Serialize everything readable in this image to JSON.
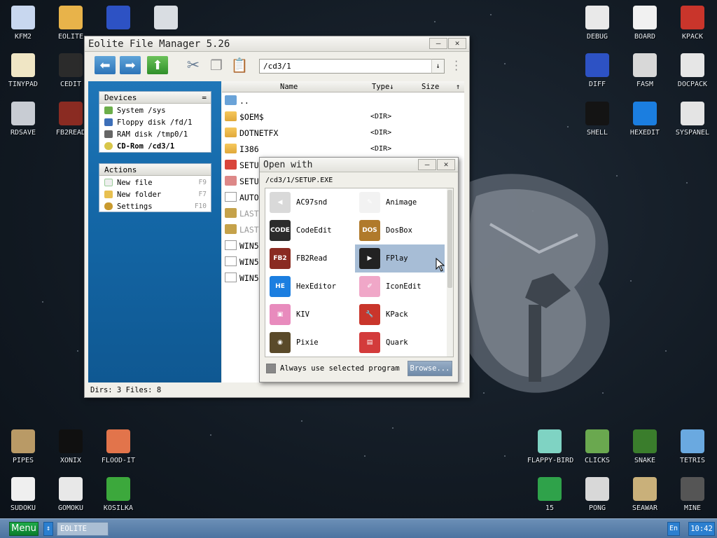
{
  "desktop": {
    "icons_left": [
      {
        "label": "KFM2",
        "icon": "floppy-icon",
        "color": "#c8d7ef"
      },
      {
        "label": "EOLITE",
        "icon": "folder-icon",
        "color": "#e8b34a"
      },
      {
        "label": "",
        "icon": "screen-grid-icon",
        "color": "#2d52c4"
      },
      {
        "label": "",
        "icon": "calculator-icon",
        "color": "#d9dde2"
      },
      {
        "label": "TINYPAD",
        "icon": "notepad-icon",
        "color": "#f0e6c5"
      },
      {
        "label": "CEDIT",
        "icon": "code-icon",
        "color": "#2b2b2b"
      },
      {
        "label": "RDSAVE",
        "icon": "ramdisk-icon",
        "color": "#c8ccd3"
      },
      {
        "label": "FB2READ",
        "icon": "book-icon",
        "color": "#8a2b22"
      }
    ],
    "icons_right": [
      {
        "label": "DEBUG",
        "icon": "debug-icon",
        "color": "#e9e9e9"
      },
      {
        "label": "BOARD",
        "icon": "board-icon",
        "color": "#f1f1f1"
      },
      {
        "label": "KPACK",
        "icon": "wrench-icon",
        "color": "#c9352b"
      },
      {
        "label": "DIFF",
        "icon": "diff-icon",
        "color": "#2d52c4"
      },
      {
        "label": "FASM",
        "icon": "fasm-icon",
        "color": "#d8d8d8"
      },
      {
        "label": "DOCPACK",
        "icon": "docpack-icon",
        "color": "#e6e6e6"
      },
      {
        "label": "SHELL",
        "icon": "shell-icon",
        "color": "#141414"
      },
      {
        "label": "HEXEDIT",
        "icon": "he-icon",
        "color": "#1b7ee0"
      },
      {
        "label": "SYSPANEL",
        "icon": "sliders-icon",
        "color": "#e4e4e4"
      }
    ],
    "icons_bottom_left": [
      {
        "label": "PIPES",
        "icon": "pipes-icon",
        "color": "#b99a66"
      },
      {
        "label": "XONIX",
        "icon": "xonix-icon",
        "color": "#101010"
      },
      {
        "label": "FLOOD-IT",
        "icon": "flood-icon",
        "color": "#e2744b"
      },
      {
        "label": "SUDOKU",
        "icon": "sudoku-icon",
        "color": "#efefef"
      },
      {
        "label": "GOMOKU",
        "icon": "gomoku-icon",
        "color": "#e8e8e8"
      },
      {
        "label": "KOSILKA",
        "icon": "mower-icon",
        "color": "#3ca83c"
      }
    ],
    "icons_bottom_right": [
      {
        "label": "FLAPPY-BIRD",
        "icon": "bird-icon",
        "color": "#7fd3c3"
      },
      {
        "label": "CLICKS",
        "icon": "clicks-icon",
        "color": "#6aa84f"
      },
      {
        "label": "SNAKE",
        "icon": "snake-icon",
        "color": "#3a7d2c"
      },
      {
        "label": "TETRIS",
        "icon": "tetris-icon",
        "color": "#6aa9e0"
      },
      {
        "label": "15",
        "icon": "fifteen-icon",
        "color": "#2fa24a"
      },
      {
        "label": "PONG",
        "icon": "pong-icon",
        "color": "#d8d8d8"
      },
      {
        "label": "SEAWAR",
        "icon": "ship-icon",
        "color": "#c9b07a"
      },
      {
        "label": "MINE",
        "icon": "mine-icon",
        "color": "#555555"
      }
    ]
  },
  "filemanager": {
    "title": "Eolite File Manager 5.26",
    "address": "/cd3/1",
    "devices": {
      "header": "Devices",
      "header_btn": "=",
      "items": [
        {
          "label": "System /sys",
          "bold": false
        },
        {
          "label": "Floppy disk /fd/1",
          "bold": false
        },
        {
          "label": "RAM disk /tmp0/1",
          "bold": false
        },
        {
          "label": "CD-Rom /cd3/1",
          "bold": true
        }
      ]
    },
    "actions": {
      "header": "Actions",
      "items": [
        {
          "label": "New file",
          "key": "F9"
        },
        {
          "label": "New folder",
          "key": "F7"
        },
        {
          "label": "Settings",
          "key": "F10"
        }
      ]
    },
    "columns": {
      "name": "Name",
      "type": "Type",
      "type_sort": "↓",
      "size": "Size"
    },
    "files": [
      {
        "name": "..",
        "type": "",
        "kind": "up"
      },
      {
        "name": "$OEM$",
        "type": "<DIR>",
        "kind": "folder"
      },
      {
        "name": "DOTNETFX",
        "type": "<DIR>",
        "kind": "folder"
      },
      {
        "name": "I386",
        "type": "<DIR>",
        "kind": "folder"
      },
      {
        "name": "SETU",
        "type": "",
        "kind": "exe"
      },
      {
        "name": "SETU",
        "type": "",
        "kind": "img"
      },
      {
        "name": "AUTO",
        "type": "",
        "kind": "doc"
      },
      {
        "name": "LAST",
        "type": "",
        "kind": "gear"
      },
      {
        "name": "LAST",
        "type": "",
        "kind": "gear"
      },
      {
        "name": "WIN5",
        "type": "",
        "kind": "doc"
      },
      {
        "name": "WIN5",
        "type": "",
        "kind": "doc"
      },
      {
        "name": "WIN5",
        "type": "",
        "kind": "doc"
      }
    ],
    "status": "Dirs: 3  Files: 8"
  },
  "openwith": {
    "title": "Open with",
    "path": "/cd3/1/SETUP.EXE",
    "apps": [
      {
        "name": "AC97snd",
        "icon": "speaker-icon",
        "color": "#d9d9d9",
        "glyph": "◀"
      },
      {
        "name": "Animage",
        "icon": "pencil-icon",
        "color": "#f2f2f2",
        "glyph": "✎"
      },
      {
        "name": "CodeEdit",
        "icon": "code-icon",
        "color": "#2b2b2b",
        "glyph": "CODE"
      },
      {
        "name": "DosBox",
        "icon": "dosbox-icon",
        "color": "#b07a2b",
        "glyph": "DOS"
      },
      {
        "name": "FB2Read",
        "icon": "book-icon",
        "color": "#8a2b22",
        "glyph": "FB2"
      },
      {
        "name": "FPlay",
        "icon": "play-icon",
        "color": "#222222",
        "glyph": "▶"
      },
      {
        "name": "HexEditor",
        "icon": "he-icon",
        "color": "#1b7ee0",
        "glyph": "HE"
      },
      {
        "name": "IconEdit",
        "icon": "eraser-icon",
        "color": "#f0a7c8",
        "glyph": "✐"
      },
      {
        "name": "KIV",
        "icon": "picture-icon",
        "color": "#e88bbd",
        "glyph": "▣"
      },
      {
        "name": "KPack",
        "icon": "wrench-icon",
        "color": "#c9352b",
        "glyph": "🔧"
      },
      {
        "name": "Pixie",
        "icon": "speaker-box-icon",
        "color": "#5a4a2a",
        "glyph": "◉"
      },
      {
        "name": "Quark",
        "icon": "notebook-icon",
        "color": "#d33b3b",
        "glyph": "▤"
      }
    ],
    "selected": "FPlay",
    "always_use": "Always use selected program",
    "browse": "Browse..."
  },
  "taskbar": {
    "menu": "Menu",
    "switch": "↕",
    "task": "EOLITE",
    "lang": "En",
    "clock": "10:42"
  }
}
